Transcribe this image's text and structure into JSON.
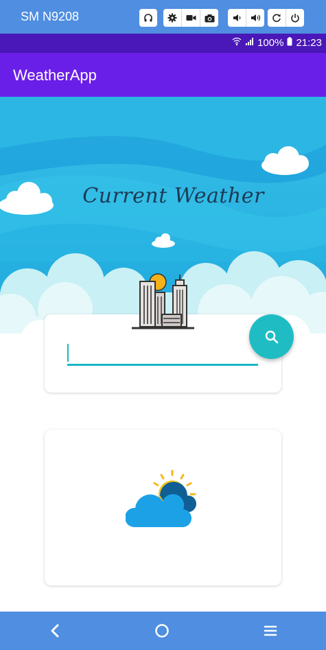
{
  "emulator": {
    "device_name": "SM N9208",
    "controls": [
      "headphones-icon",
      "gear-icon",
      "video-camera-icon",
      "camera-icon",
      "volume-down-icon",
      "volume-up-icon",
      "rotate-icon",
      "power-icon"
    ]
  },
  "status_bar": {
    "battery": "100%",
    "time": "21:23"
  },
  "app": {
    "title": "WeatherApp",
    "heading": "Current Weather"
  },
  "search": {
    "value": "",
    "placeholder": ""
  },
  "colors": {
    "app_bar": "#6a1fe8",
    "status_bar": "#4a17b8",
    "accent": "#1fbdc3",
    "emulator_bar": "#4f8ee0"
  },
  "navigation": [
    "back-icon",
    "home-icon",
    "menu-icon"
  ]
}
